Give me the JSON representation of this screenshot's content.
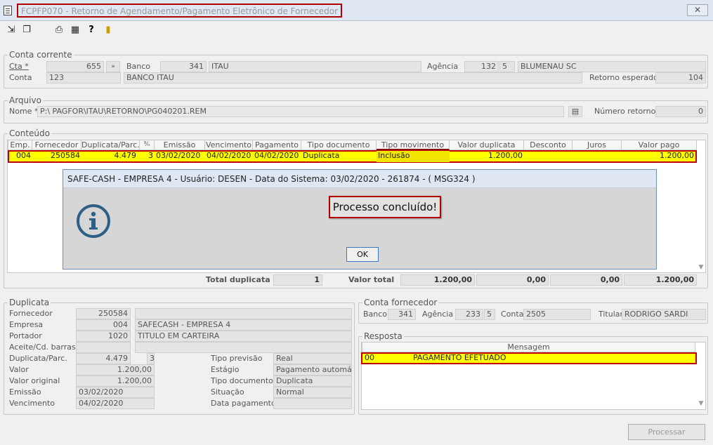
{
  "window": {
    "title": "FCPFP070 - Retorno de Agendamento/Pagamento Eletrônico de Fornecedor",
    "close": "✕"
  },
  "toolbar": {
    "icons": [
      "arrow-in-icon",
      "windows-icon",
      "printer-icon",
      "calendar-grid-icon",
      "help-icon",
      "exit-door-icon"
    ]
  },
  "conta_corrente": {
    "title": "Conta corrente",
    "cta_label": "Cta *",
    "cta_value": "655",
    "banco_label": "Banco",
    "banco_code": "341",
    "banco_name": "ITAU",
    "agencia_label": "Agência",
    "agencia_num": "132",
    "agencia_dv": "5",
    "agencia_city": "BLUMENAU SC",
    "conta_label": "Conta",
    "conta_num": "123",
    "conta_bank": "BANCO ITAU",
    "retorno_label": "Retorno esperado",
    "retorno_value": "104"
  },
  "arquivo": {
    "title": "Arquivo",
    "nome_label": "Nome *",
    "nome_value": "P:\\                PAGFOR\\ITAU\\RETORNO\\PG040201.REM",
    "numero_label": "Número retorno",
    "numero_value": "0"
  },
  "conteudo": {
    "title": "Conteúdo",
    "headers": [
      "Emp.",
      "Fornecedor",
      "Duplicata/Parc.",
      "",
      "Emissão",
      "Vencimento",
      "Pagamento",
      "Tipo documento",
      "Tipo movimento",
      "Valor duplicata",
      "Desconto",
      "Juros",
      "Valor pago"
    ],
    "row": {
      "emp": "004",
      "fornecedor": "250584",
      "duplicata": "4.479",
      "parc": "3",
      "emissao": "03/02/2020",
      "vencimento": "04/02/2020",
      "pagamento": "04/02/2020",
      "tipo_documento": "Duplicata",
      "tipo_movimento": "Inclusão",
      "valor_duplicata": "1.200,00",
      "desconto": "",
      "juros": "",
      "valor_pago": "1.200,00"
    },
    "total_dup_label": "Total duplicata",
    "total_dup_value": "1",
    "valor_total_label": "Valor total",
    "valor_total_value": "1.200,00",
    "desconto_total": "0,00",
    "juros_total": "0,00",
    "pago_total": "1.200,00"
  },
  "dialog": {
    "title": "SAFE-CASH - EMPRESA 4 - Usuário: DESEN - Data do Sistema: 03/02/2020 - 261874 - ( MSG324 )",
    "message": "Processo concluído!",
    "ok": "OK",
    "icon": "info-icon"
  },
  "duplicata": {
    "title": "Duplicata",
    "fornecedor_label": "Fornecedor",
    "fornecedor_code": "250584",
    "empresa_label": "Empresa",
    "empresa_code": "004",
    "empresa_name": "SAFECASH -  EMPRESA 4",
    "portador_label": "Portador",
    "portador_code": "1020",
    "portador_name": "TITULO EM CARTEIRA",
    "aceite_label": "Aceite/Cd. barras",
    "dup_label": "Duplicata/Parc.",
    "dup_value": "4.479",
    "dup_parc": "3",
    "valor_label": "Valor",
    "valor_value": "1.200,00",
    "valor_original_label": "Valor original",
    "valor_original_value": "1.200,00",
    "emissao_label": "Emissão",
    "emissao_value": "03/02/2020",
    "vencimento_label": "Vencimento",
    "vencimento_value": "04/02/2020",
    "tipo_previsao_label": "Tipo previsão",
    "tipo_previsao_value": "Real",
    "estagio_label": "Estágio",
    "estagio_value": "Pagamento automático",
    "tipo_doc_label": "Tipo documento",
    "tipo_doc_value": "Duplicata",
    "situacao_label": "Situação",
    "situacao_value": "Normal",
    "data_pag_label": "Data pagamento"
  },
  "conta_fornecedor": {
    "title": "Conta fornecedor",
    "banco_label": "Banco",
    "banco_value": "341",
    "agencia_label": "Agência",
    "agencia_value": "233",
    "agencia_dv": "5",
    "conta_label": "Conta",
    "conta_value": "2505",
    "titular_label": "Titular",
    "titular_value": "RODRIGO SARDI"
  },
  "resposta": {
    "title": "Resposta",
    "header": "Mensagem",
    "code": "00",
    "message": "PAGAMENTO EFETUADO"
  },
  "footer": {
    "processar": "Processar"
  },
  "colors": {
    "highlight_yellow": "#ffff00",
    "highlight_border": "#c00000",
    "info_blue": "#2e5f85"
  }
}
